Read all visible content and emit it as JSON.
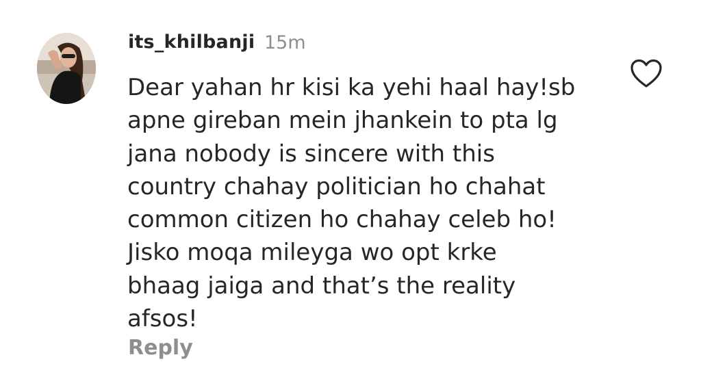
{
  "comment": {
    "username": "its_khilbanji",
    "timestamp": "15m",
    "text_lines": [
      "Dear yahan hr kisi ka yehi haal hay!sb",
      "apne gireban mein jhankein to pta lg",
      "jana nobody is sincere with this",
      "country chahay politician ho chahat",
      "common citizen ho chahay celeb ho!",
      "Jisko moqa mileyga wo opt krke",
      "bhaag jaiga and that’s the reality",
      "afsos!"
    ],
    "reply_label": "Reply",
    "like_icon": "heart-outline-icon",
    "avatar_icon": "user-avatar"
  },
  "colors": {
    "primary_text": "#262626",
    "secondary_text": "#8e8e8e",
    "background": "#ffffff"
  }
}
